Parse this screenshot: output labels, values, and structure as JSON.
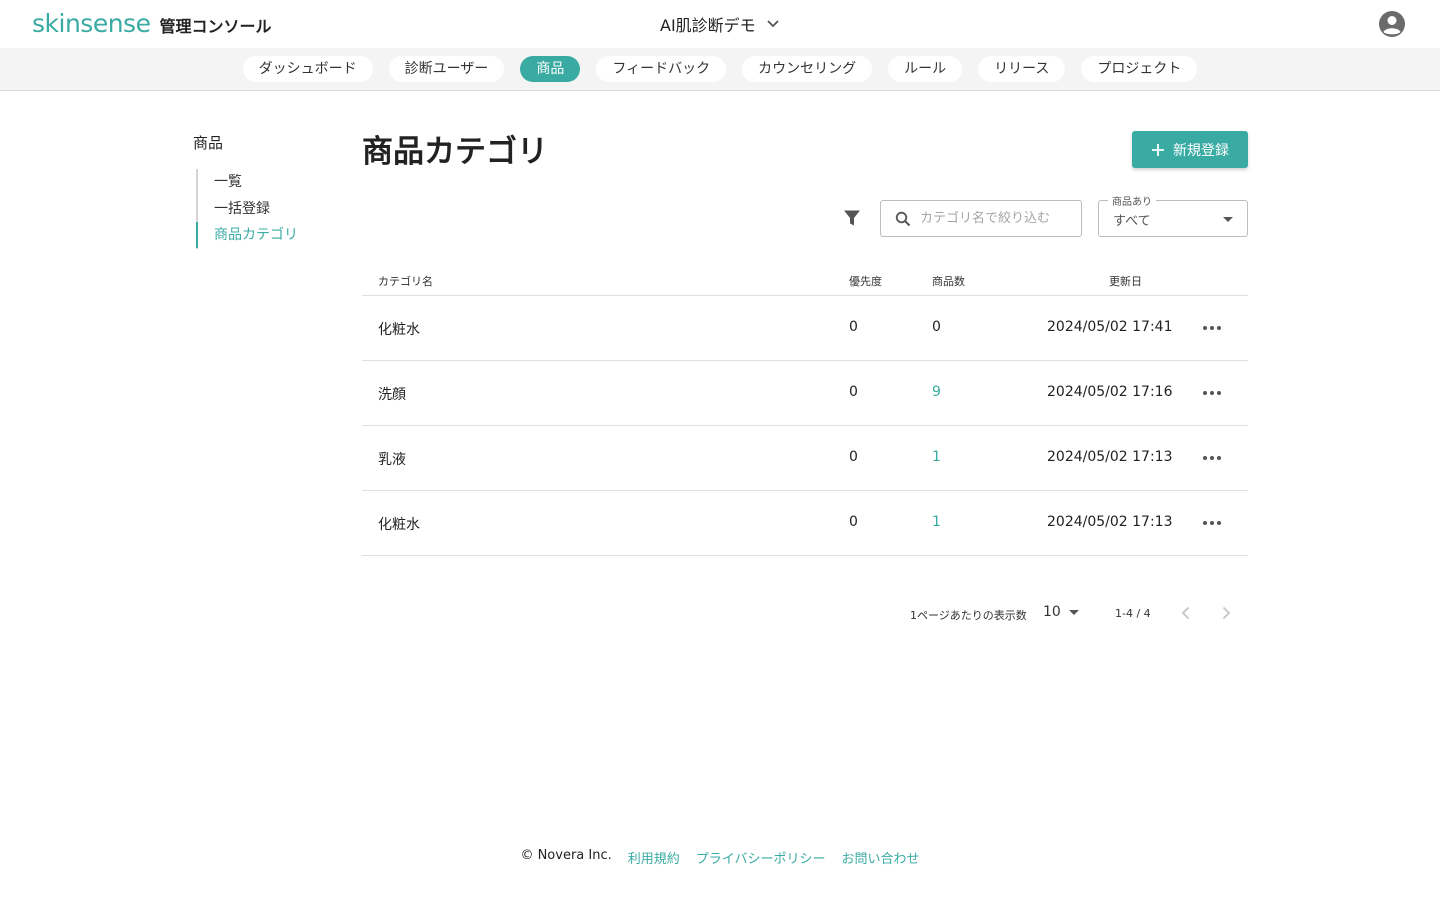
{
  "header": {
    "logo_word": "skinsense",
    "logo_sub": "管理コンソール",
    "project_name": "AI肌診断デモ"
  },
  "nav": {
    "tabs": [
      {
        "label": "ダッシュボード",
        "active": false
      },
      {
        "label": "診断ユーザー",
        "active": false
      },
      {
        "label": "商品",
        "active": true
      },
      {
        "label": "フィードバック",
        "active": false
      },
      {
        "label": "カウンセリング",
        "active": false
      },
      {
        "label": "ルール",
        "active": false
      },
      {
        "label": "リリース",
        "active": false
      },
      {
        "label": "プロジェクト",
        "active": false
      }
    ]
  },
  "sidebar": {
    "title": "商品",
    "items": [
      {
        "label": "一覧",
        "active": false
      },
      {
        "label": "一括登録",
        "active": false
      },
      {
        "label": "商品カテゴリ",
        "active": true
      }
    ]
  },
  "main": {
    "title": "商品カテゴリ",
    "new_button_label": "新規登録",
    "search": {
      "placeholder": "カテゴリ名で絞り込む",
      "value": ""
    },
    "has_products_filter": {
      "label": "商品あり",
      "value": "すべて"
    },
    "table": {
      "columns": {
        "name": "カテゴリ名",
        "priority": "優先度",
        "count": "商品数",
        "updated": "更新日"
      },
      "rows": [
        {
          "name": "化粧水",
          "priority": "0",
          "count": "0",
          "count_link": false,
          "updated": "2024/05/02 17:41"
        },
        {
          "name": "洗顔",
          "priority": "0",
          "count": "9",
          "count_link": true,
          "updated": "2024/05/02 17:16"
        },
        {
          "name": "乳液",
          "priority": "0",
          "count": "1",
          "count_link": true,
          "updated": "2024/05/02 17:13"
        },
        {
          "name": "化粧水",
          "priority": "0",
          "count": "1",
          "count_link": true,
          "updated": "2024/05/02 17:13"
        }
      ]
    },
    "pagination": {
      "per_page_label": "1ページあたりの表示数",
      "per_page": "10",
      "range": "1-4 / 4"
    }
  },
  "footer": {
    "copyright": "© Novera Inc.",
    "links": [
      "利用規約",
      "プライバシーポリシー",
      "お問い合わせ"
    ]
  },
  "colors": {
    "accent": "#3aaba3",
    "text": "#222222",
    "nav_bg": "#f4f4f4"
  },
  "icons": {
    "project": "chevron-down-icon",
    "account": "account-circle-icon",
    "add": "plus-icon",
    "filter": "filter-icon",
    "search": "search-icon",
    "row_menu": "more-horizontal-icon",
    "prev": "chevron-left-icon",
    "next": "chevron-right-icon"
  }
}
